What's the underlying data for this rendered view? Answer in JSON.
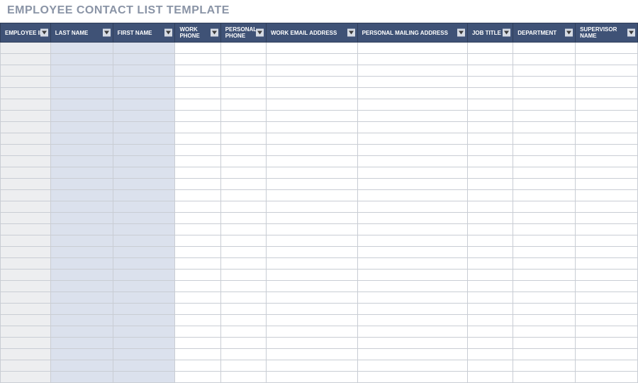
{
  "title": "EMPLOYEE CONTACT LIST TEMPLATE",
  "columns": [
    {
      "key": "employee_id",
      "label": "EMPLOYEE ID",
      "cls": "col-emp",
      "bg": "bg-grey"
    },
    {
      "key": "last_name",
      "label": "LAST NAME",
      "cls": "col-last",
      "bg": "bg-blue"
    },
    {
      "key": "first_name",
      "label": "FIRST NAME",
      "cls": "col-first",
      "bg": "bg-blue"
    },
    {
      "key": "work_phone",
      "label": "WORK PHONE",
      "cls": "col-wph",
      "bg": "bg-white"
    },
    {
      "key": "personal_phone",
      "label": "PERSONAL PHONE",
      "cls": "col-pph",
      "bg": "bg-white"
    },
    {
      "key": "work_email",
      "label": "WORK EMAIL ADDRESS",
      "cls": "col-wem",
      "bg": "bg-white"
    },
    {
      "key": "personal_mailing",
      "label": "PERSONAL MAILING ADDRESS",
      "cls": "col-pma",
      "bg": "bg-white"
    },
    {
      "key": "job_title",
      "label": "JOB TITLE",
      "cls": "col-job",
      "bg": "bg-white"
    },
    {
      "key": "department",
      "label": "DEPARTMENT",
      "cls": "col-dept",
      "bg": "bg-white"
    },
    {
      "key": "supervisor",
      "label": "SUPERVISOR NAME",
      "cls": "col-sup",
      "bg": "bg-white"
    }
  ],
  "row_count": 30,
  "colors": {
    "header_bg": "#3f5276",
    "title_color": "#8a94a6",
    "grey_col": "#edeef0",
    "blue_col": "#dbe1ed"
  }
}
